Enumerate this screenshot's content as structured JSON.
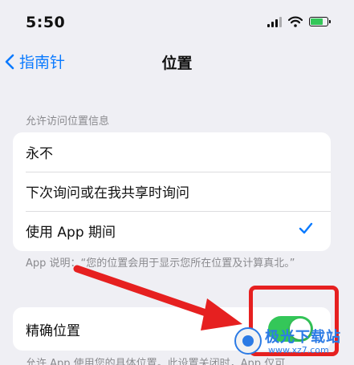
{
  "status_bar": {
    "time": "5:50"
  },
  "nav": {
    "back_label": "指南针",
    "title": "位置"
  },
  "location_access": {
    "header": "允许访问位置信息",
    "options": [
      {
        "label": "永不",
        "selected": false
      },
      {
        "label": "下次询问或在我共享时询问",
        "selected": false
      },
      {
        "label": "使用 App 期间",
        "selected": true
      }
    ],
    "footer": "App 说明：“您的位置会用于显示您所在位置及计算真北。”"
  },
  "precise_location": {
    "label": "精确位置",
    "enabled": true
  },
  "bottom_note": "允许 App 使用您的具体位置。此设置关闭时，App 仅可",
  "watermark": {
    "name": "极光下载站",
    "url": "www.xz7.com"
  },
  "colors": {
    "accent": "#0a7aff",
    "toggle_on": "#34c759",
    "annotation": "#e62020"
  }
}
